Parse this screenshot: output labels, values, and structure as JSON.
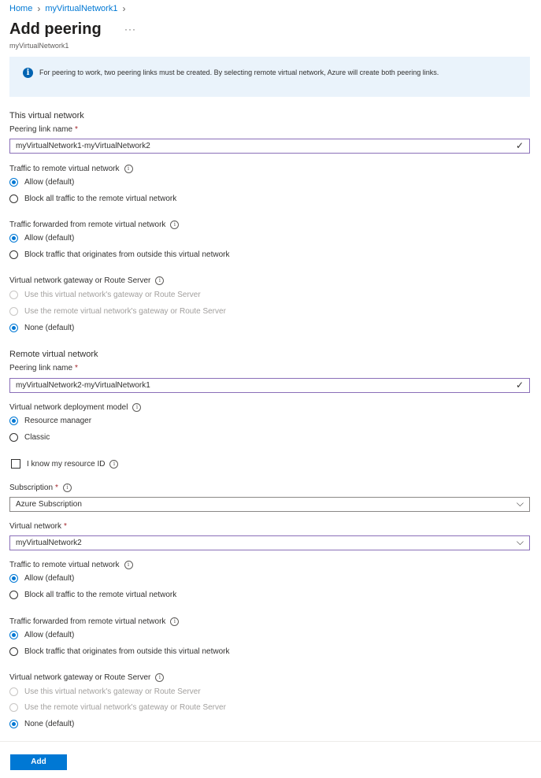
{
  "breadcrumb": {
    "home": "Home",
    "network": "myVirtualNetwork1"
  },
  "page": {
    "title": "Add peering",
    "ellipsis": "···",
    "subtitle": "myVirtualNetwork1"
  },
  "info": {
    "icon": "info-icon",
    "text": "For peering to work, two peering links must be created. By selecting remote virtual network, Azure will create both peering links."
  },
  "this_vnet": {
    "heading": "This virtual network",
    "peering_label": "Peering link name",
    "peering_value": "myVirtualNetwork1-myVirtualNetwork2",
    "traffic_to": {
      "label": "Traffic to remote virtual network",
      "opt1": "Allow (default)",
      "opt2": "Block all traffic to the remote virtual network"
    },
    "traffic_fwd": {
      "label": "Traffic forwarded from remote virtual network",
      "opt1": "Allow (default)",
      "opt2": "Block traffic that originates from outside this virtual network"
    },
    "gateway": {
      "label": "Virtual network gateway or Route Server",
      "opt1": "Use this virtual network's gateway or Route Server",
      "opt2": "Use the remote virtual network's gateway or Route Server",
      "opt3": "None (default)"
    }
  },
  "remote_vnet": {
    "heading": "Remote virtual network",
    "peering_label": "Peering link name",
    "peering_value": "myVirtualNetwork2-myVirtualNetwork1",
    "deploy": {
      "label": "Virtual network deployment model",
      "opt1": "Resource manager",
      "opt2": "Classic"
    },
    "resource_id_label": "I know my resource ID",
    "subscription": {
      "label": "Subscription",
      "value": "Azure Subscription"
    },
    "vnet": {
      "label": "Virtual network",
      "value": "myVirtualNetwork2"
    },
    "traffic_to": {
      "label": "Traffic to remote virtual network",
      "opt1": "Allow (default)",
      "opt2": "Block all traffic to the remote virtual network"
    },
    "traffic_fwd": {
      "label": "Traffic forwarded from remote virtual network",
      "opt1": "Allow (default)",
      "opt2": "Block traffic that originates from outside this virtual network"
    },
    "gateway": {
      "label": "Virtual network gateway or Route Server",
      "opt1": "Use this virtual network's gateway or Route Server",
      "opt2": "Use the remote virtual network's gateway or Route Server",
      "opt3": "None (default)"
    }
  },
  "buttons": {
    "add": "Add"
  },
  "colors": {
    "accent": "#0078d4",
    "info_bg": "#eaf3fb",
    "required": "#a4262c"
  }
}
